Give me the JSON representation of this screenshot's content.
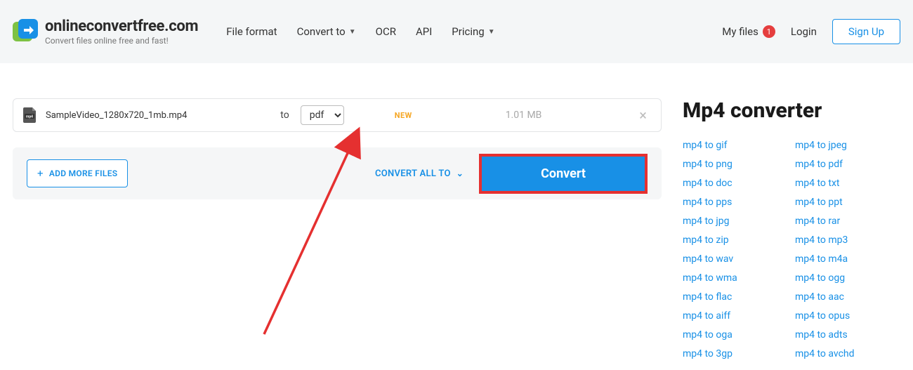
{
  "header": {
    "site_title": "onlineconvertfree.com",
    "site_tagline": "Convert files online free and fast!",
    "nav": {
      "file_format": "File format",
      "convert_to": "Convert to",
      "ocr": "OCR",
      "api": "API",
      "pricing": "Pricing"
    },
    "my_files": "My files",
    "my_files_badge": "1",
    "login": "Login",
    "signup": "Sign Up"
  },
  "file_row": {
    "file_name": "SampleVideo_1280x720_1mb.mp4",
    "to_label": "to",
    "selected_format": "pdf",
    "new_tag": "NEW",
    "file_size": "1.01 MB"
  },
  "action_bar": {
    "add_more": "ADD MORE FILES",
    "convert_all_to": "CONVERT ALL TO",
    "convert": "Convert"
  },
  "sidebar": {
    "title": "Mp4 converter",
    "col1": [
      "mp4 to gif",
      "mp4 to png",
      "mp4 to doc",
      "mp4 to pps",
      "mp4 to jpg",
      "mp4 to zip",
      "mp4 to wav",
      "mp4 to wma",
      "mp4 to flac",
      "mp4 to aiff",
      "mp4 to oga",
      "mp4 to 3gp"
    ],
    "col2": [
      "mp4 to jpeg",
      "mp4 to pdf",
      "mp4 to txt",
      "mp4 to ppt",
      "mp4 to rar",
      "mp4 to mp3",
      "mp4 to m4a",
      "mp4 to ogg",
      "mp4 to aac",
      "mp4 to opus",
      "mp4 to adts",
      "mp4 to avchd"
    ]
  }
}
